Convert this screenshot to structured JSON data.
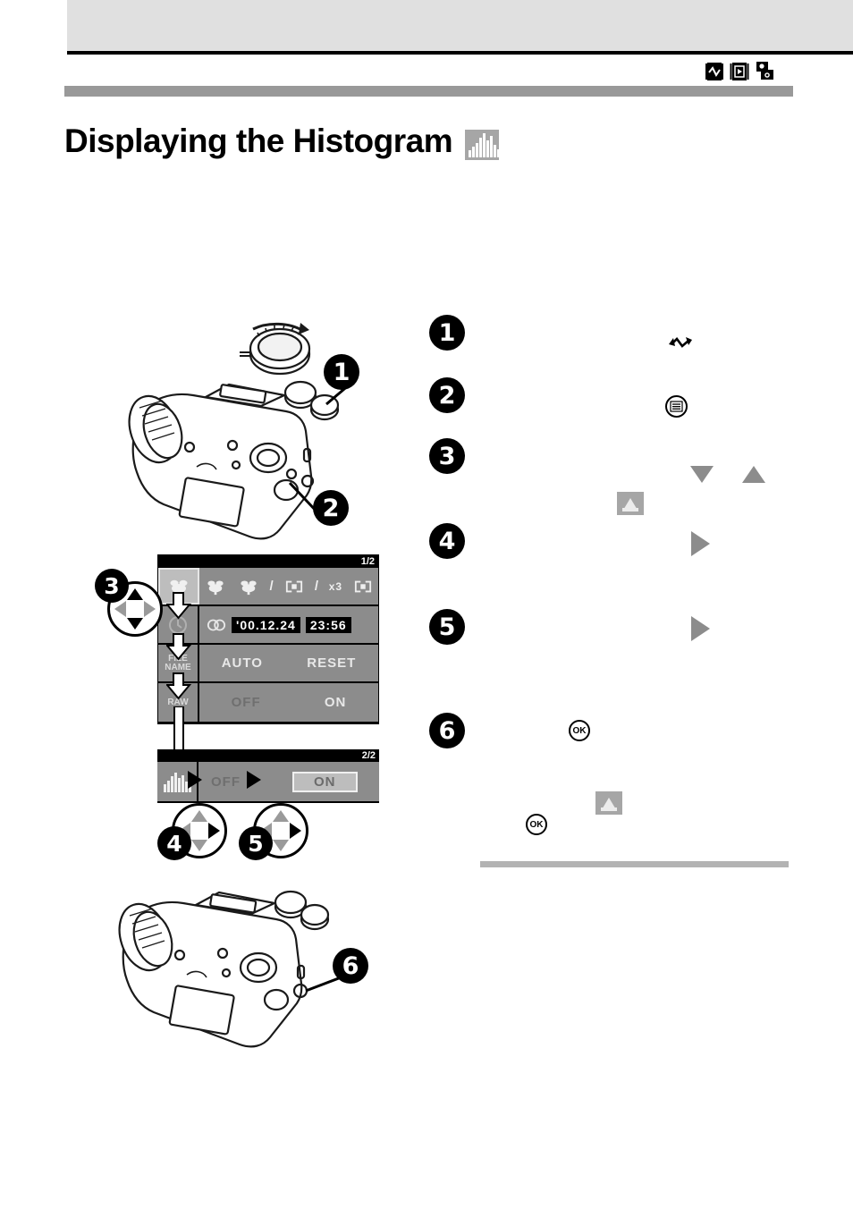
{
  "page": {
    "title": "Displaying the Histogram",
    "title_icon": "histogram-icon"
  },
  "header": {
    "mode_icons": [
      {
        "name": "dial-waveform-icon",
        "label": ""
      },
      {
        "name": "playback-icon",
        "label": ""
      },
      {
        "name": "dual-camera-icon",
        "label": ""
      }
    ]
  },
  "illustrations": {
    "camera_top": {
      "name": "camera-body-front-top-illustration",
      "callouts": [
        "1",
        "2"
      ],
      "dial_label": "mode-dial"
    },
    "camera_bottom": {
      "name": "camera-body-rear-illustration",
      "callouts": [
        "6"
      ]
    }
  },
  "lcd_screen_1": {
    "page_indicator": "1/2",
    "rows": [
      {
        "label": "",
        "label_icon": "macro-flower-icon",
        "values": [
          "macro-flower-icon",
          "macro-flower-icon",
          "/",
          "frame-icon",
          "/",
          "x3",
          "frame-icon"
        ],
        "selected": "macro-flower-icon"
      },
      {
        "label": "",
        "label_icon": "clock-icon",
        "values": [
          "'00.12.24",
          "23:56"
        ],
        "selected": ""
      },
      {
        "label": "FILE NAME",
        "values": [
          "AUTO",
          "RESET"
        ],
        "selected": ""
      },
      {
        "label": "RAW",
        "values": [
          "OFF",
          "ON"
        ],
        "selected": ""
      }
    ]
  },
  "lcd_screen_2": {
    "page_indicator": "2/2",
    "row": {
      "label_icon": "histogram-icon",
      "values": [
        "OFF",
        "ON"
      ],
      "selected": "ON"
    }
  },
  "controller_pads": [
    {
      "badge": "3",
      "highlight": [
        "up",
        "down"
      ]
    },
    {
      "badge": "4",
      "highlight": [
        "right"
      ]
    },
    {
      "badge": "5",
      "highlight": [
        "right"
      ]
    }
  ],
  "steps": [
    {
      "number": "1",
      "text": "",
      "icons": [
        "dial-rotate-icon"
      ]
    },
    {
      "number": "2",
      "text": "",
      "icons": [
        "menu-button-icon"
      ]
    },
    {
      "number": "3",
      "text": "",
      "icons": [
        "triangle-down-icon",
        "triangle-up-icon",
        "histogram-box-icon"
      ]
    },
    {
      "number": "4",
      "text": "",
      "icons": [
        "triangle-right-icon"
      ]
    },
    {
      "number": "5",
      "text": "",
      "icons": [
        "triangle-right-icon"
      ]
    },
    {
      "number": "6",
      "text": "",
      "icons": [
        "ok-button-icon",
        "histogram-box-icon",
        "ok-button-icon"
      ]
    }
  ],
  "colors": {
    "header_band": "#e0e0e0",
    "title_bar": "#999999",
    "footer_rule": "#b3b3b3",
    "lcd_background": "#000000",
    "lcd_row": "#8c8c8c",
    "lcd_selected": "#bdbdbd",
    "icon_gray": "#a6a6a6"
  }
}
